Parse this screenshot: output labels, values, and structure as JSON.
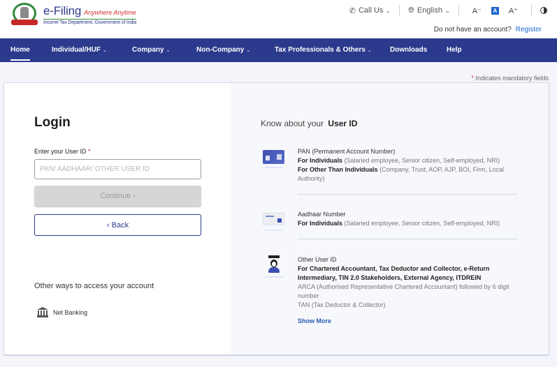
{
  "header": {
    "brand_title": "e-Filing",
    "brand_tagline": "Anywhere Anytime",
    "brand_subtitle": "Income Tax Department, Government of India",
    "call_us": "Call Us",
    "language": "English",
    "font_decrease": "A⁻",
    "font_default": "A",
    "font_increase": "A⁺",
    "register_prompt": "Do not have an account?",
    "register_link": "Register"
  },
  "nav": {
    "items": [
      {
        "label": "Home",
        "dropdown": false,
        "active": true
      },
      {
        "label": "Individual/HUF",
        "dropdown": true
      },
      {
        "label": "Company",
        "dropdown": true
      },
      {
        "label": "Non-Company",
        "dropdown": true
      },
      {
        "label": "Tax Professionals & Others",
        "dropdown": true
      },
      {
        "label": "Downloads",
        "dropdown": false
      },
      {
        "label": "Help",
        "dropdown": false
      }
    ],
    "chevron": "⌄"
  },
  "mandatory_note": {
    "star": "*",
    "text": "Indicates mandatory fields"
  },
  "login": {
    "title": "Login",
    "field_label": "Enter your User ID",
    "required_star": "*",
    "input_value": "",
    "input_placeholder": "PAN/ AADHAAR/ OTHER USER ID",
    "continue_label": "Continue ›",
    "back_label": "‹ Back",
    "other_ways": "Other ways to access your account",
    "net_banking": "Net Banking"
  },
  "know": {
    "title_prefix": "Know about your",
    "title_bold": "User ID",
    "items": [
      {
        "title": "PAN (Permanent Account Number)",
        "line1_bold": "For Individuals",
        "line1_rest": " (Salaried employee, Senior citizen, Self-employed, NRI)",
        "line2_bold": "For Other Than Individuals",
        "line2_rest": " (Company, Trust, AOP, AJP, BOI, Firm, Local Authority)"
      },
      {
        "title": "Aadhaar Number",
        "line1_bold": "For Individuals",
        "line1_rest": " (Salaried employee, Senior citizen, Self-employed, NRI)"
      },
      {
        "title": "Other User ID",
        "line1_bold": "For Chartered Accountant, Tax Deductor and Collector, e-Return Intermediary, TIN 2.0 Stakeholders, External Agency, ITDREIN",
        "line2": "ARCA (Authorised Representative Chartered Accountant) followed by 6 digit number",
        "line3": "TAN (Tax Deductor & Collector)"
      }
    ],
    "show_more": "Show More"
  }
}
